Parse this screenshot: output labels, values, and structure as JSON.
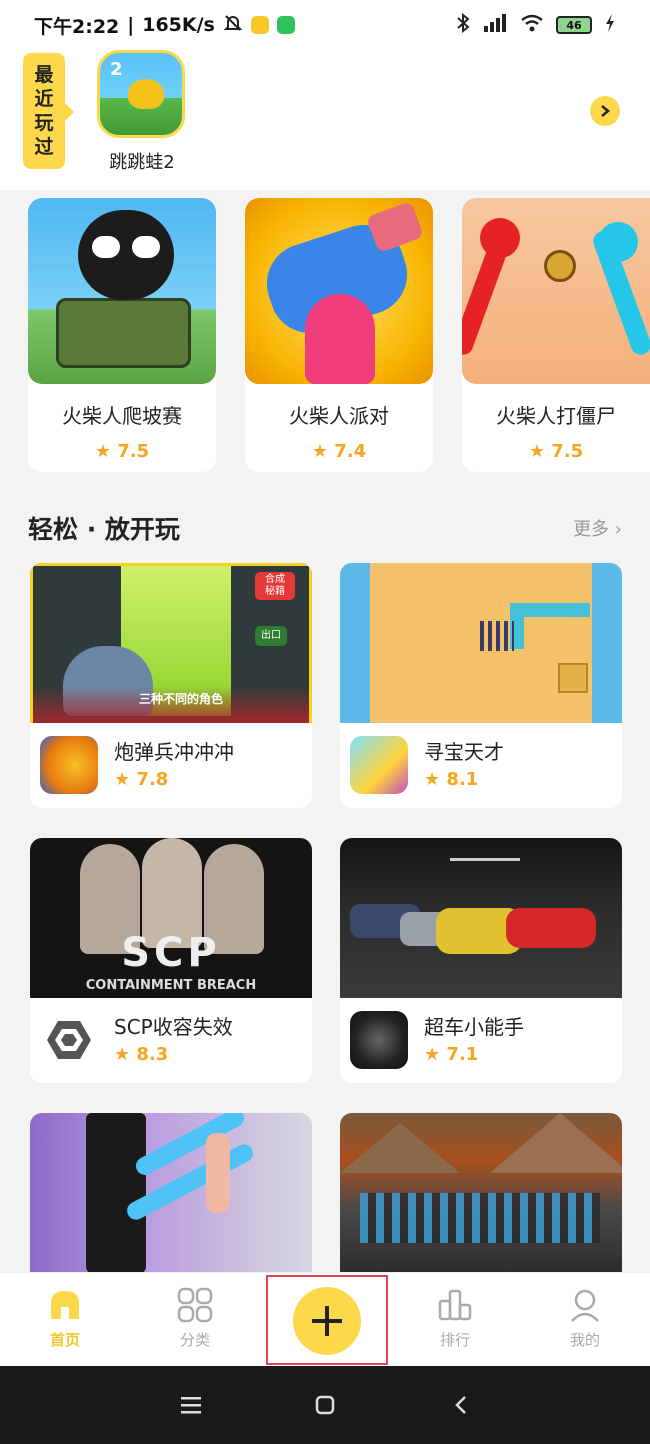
{
  "status_bar": {
    "time": "下午2:22",
    "speed": "165K/s",
    "network": "4G",
    "battery": "46"
  },
  "recent": {
    "tag_chars": [
      "最",
      "近",
      "玩",
      "过"
    ],
    "game": {
      "name": "跳跳蛙2",
      "icon_label": "2"
    },
    "more_icon": "chevron-right-icon"
  },
  "featured": [
    {
      "name": "火柴人爬坡赛",
      "rating": "7.5"
    },
    {
      "name": "火柴人派对",
      "rating": "7.4"
    },
    {
      "name": "火柴人打僵尸",
      "rating": "7.5"
    }
  ],
  "section": {
    "title": "轻松 · 放开玩",
    "more": "更多"
  },
  "grid": [
    {
      "name": "炮弹兵冲冲冲",
      "rating": "7.8",
      "img_overlay": "三种不同的角色",
      "badge1": "合成\n秘籍",
      "badge2": "出口"
    },
    {
      "name": "寻宝天才",
      "rating": "8.1"
    },
    {
      "name": "SCP收容失效",
      "rating": "8.3",
      "img_overlay_big": "SCP",
      "img_overlay_sub": "CONTAINMENT BREACH"
    },
    {
      "name": "超车小能手",
      "rating": "7.1"
    },
    {
      "name": "",
      "rating": ""
    },
    {
      "name": "",
      "rating": ""
    }
  ],
  "bottom_nav": {
    "home": "首页",
    "category": "分类",
    "rank": "排行",
    "mine": "我的"
  },
  "colors": {
    "accent": "#fed84b",
    "star": "#f5a623",
    "highlight_border": "#e0454b"
  }
}
